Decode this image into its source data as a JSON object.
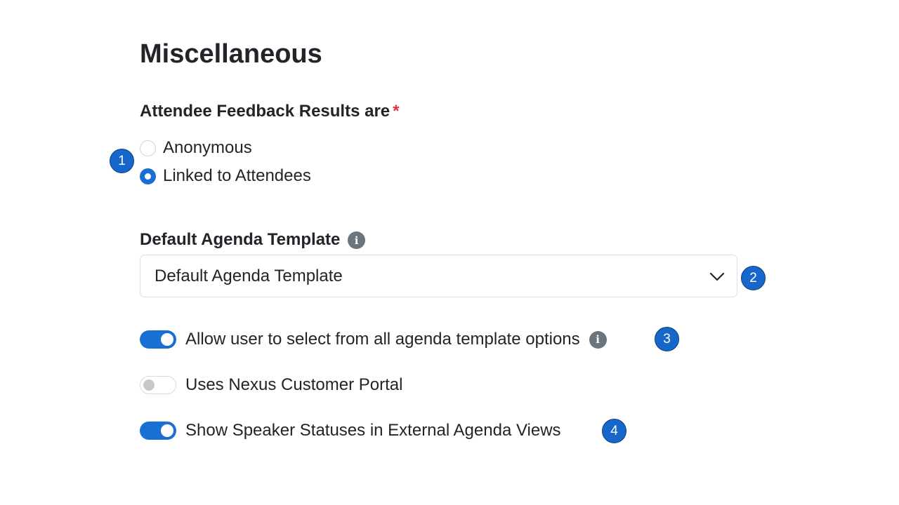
{
  "section": {
    "title": "Miscellaneous"
  },
  "feedback": {
    "label": "Attendee Feedback Results are",
    "required_mark": "*",
    "options": [
      {
        "label": "Anonymous",
        "selected": false
      },
      {
        "label": "Linked to Attendees",
        "selected": true
      }
    ]
  },
  "agenda_template": {
    "label": "Default Agenda Template",
    "info_icon": "info-icon",
    "selected_value": "Default Agenda Template"
  },
  "toggles": [
    {
      "label": "Allow user to select from all agenda template options",
      "on": true,
      "has_info": true
    },
    {
      "label": "Uses Nexus Customer Portal",
      "on": false,
      "has_info": false
    },
    {
      "label": "Show Speaker Statuses in External Agenda Views",
      "on": true,
      "has_info": false
    }
  ],
  "callouts": [
    "1",
    "2",
    "3",
    "4"
  ],
  "colors": {
    "accent": "#1a6fd4",
    "required": "#dc3545",
    "callout": "#1766c9",
    "info_icon": "#6c757d"
  }
}
